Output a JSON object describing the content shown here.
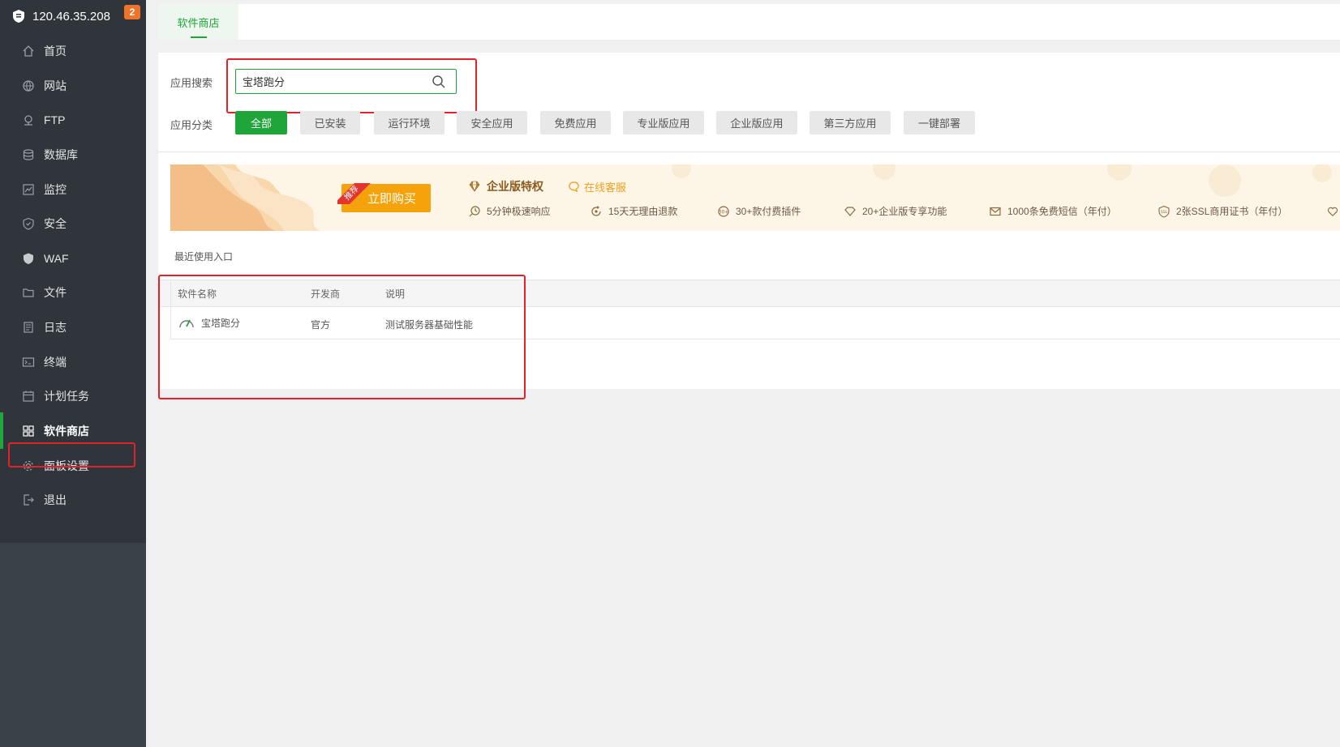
{
  "sidebar": {
    "host": "120.46.35.208",
    "badge": "2",
    "items": [
      {
        "label": "首页",
        "icon": "home-icon"
      },
      {
        "label": "网站",
        "icon": "globe-icon"
      },
      {
        "label": "FTP",
        "icon": "ftp-icon"
      },
      {
        "label": "数据库",
        "icon": "database-icon"
      },
      {
        "label": "监控",
        "icon": "monitor-icon"
      },
      {
        "label": "安全",
        "icon": "shield-icon"
      },
      {
        "label": "WAF",
        "icon": "waf-shield-icon"
      },
      {
        "label": "文件",
        "icon": "folder-icon"
      },
      {
        "label": "日志",
        "icon": "log-icon"
      },
      {
        "label": "终端",
        "icon": "terminal-icon"
      },
      {
        "label": "计划任务",
        "icon": "calendar-icon"
      },
      {
        "label": "软件商店",
        "icon": "grid-icon",
        "active": true
      },
      {
        "label": "面板设置",
        "icon": "gear-icon"
      },
      {
        "label": "退出",
        "icon": "logout-icon"
      }
    ]
  },
  "tabs": [
    {
      "label": "软件商店",
      "active": true
    }
  ],
  "search": {
    "label": "应用搜索",
    "value": "宝塔跑分",
    "icon": "search-icon"
  },
  "categories": {
    "label": "应用分类",
    "items": [
      "全部",
      "已安装",
      "运行环境",
      "安全应用",
      "免费应用",
      "专业版应用",
      "企业版应用",
      "第三方应用",
      "一键部署"
    ],
    "active": "全部"
  },
  "banner": {
    "ribbon": "推荐",
    "buy_label": "立即购买",
    "title": "企业版特权",
    "service": "在线客服",
    "features": [
      {
        "text": "5分钟极速响应",
        "icon": "fast-response-icon"
      },
      {
        "text": "15天无理由退款",
        "icon": "refund-icon"
      },
      {
        "text": "30+款付费插件",
        "icon": "plugin-icon"
      },
      {
        "text": "20+企业版专享功能",
        "icon": "diamond-icon"
      },
      {
        "text": "1000条免费短信（年付）",
        "icon": "mail-icon"
      },
      {
        "text": "2张SSL商用证书（年付）",
        "icon": "ssl-icon"
      }
    ]
  },
  "recent_label": "最近使用入口",
  "table": {
    "headers": [
      "软件名称",
      "开发商",
      "说明"
    ],
    "rows": [
      {
        "name": "宝塔跑分",
        "vendor": "官方",
        "desc": "测试服务器基础性能",
        "icon": "gauge-icon"
      }
    ]
  },
  "colors": {
    "accent": "#20a53a",
    "sidebar_bg": "#3b4148",
    "highlight_border": "#e2222a",
    "buy_button": "#f5a20b"
  }
}
